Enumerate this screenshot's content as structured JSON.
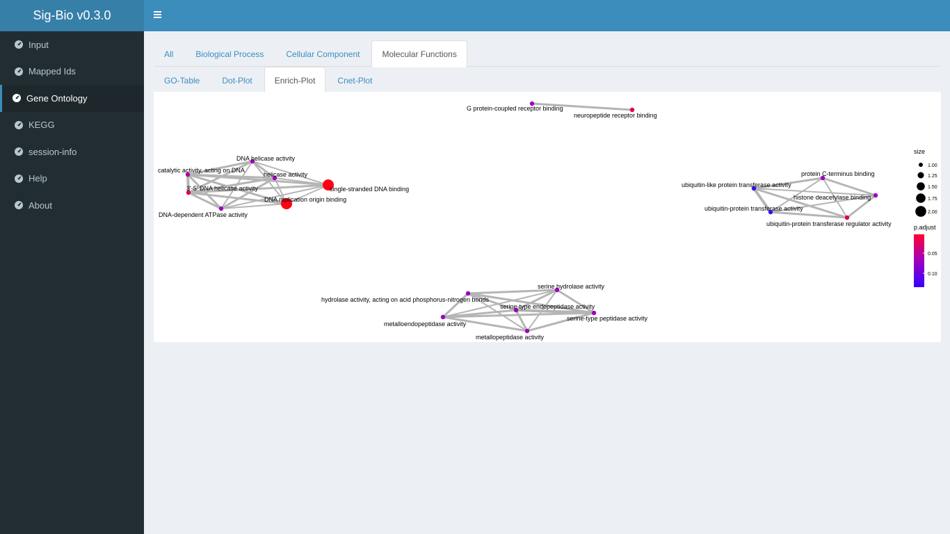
{
  "header": {
    "app_title": "Sig-Bio v0.3.0",
    "menu_icon": "hamburger-icon"
  },
  "sidebar": {
    "items": [
      {
        "label": "Input",
        "icon": "dashboard-icon",
        "active": false
      },
      {
        "label": "Mapped Ids",
        "icon": "dashboard-icon",
        "active": false
      },
      {
        "label": "Gene Ontology",
        "icon": "dashboard-icon",
        "active": true
      },
      {
        "label": "KEGG",
        "icon": "dashboard-icon",
        "active": false
      },
      {
        "label": "session-info",
        "icon": "dashboard-icon",
        "active": false
      },
      {
        "label": "Help",
        "icon": "dashboard-icon",
        "active": false
      },
      {
        "label": "About",
        "icon": "dashboard-icon",
        "active": false
      }
    ]
  },
  "tabs_primary": [
    "All",
    "Biological Process",
    "Cellular Component",
    "Molecular Functions"
  ],
  "tabs_primary_active": "Molecular Functions",
  "tabs_secondary": [
    "GO-Table",
    "Dot-Plot",
    "Enrich-Plot",
    "Cnet-Plot"
  ],
  "tabs_secondary_active": "Enrich-Plot",
  "legend": {
    "size_title": "size",
    "size_labels": [
      "1.00",
      "1.25",
      "1.50",
      "1.75",
      "2.00"
    ],
    "color_title": "p.adjust",
    "color_labels": [
      "0.05",
      "0.10"
    ],
    "color_high": "#ff0033",
    "color_low": "#3300ff"
  },
  "network": {
    "nodes": [
      {
        "id": "gpcr",
        "label": "G protein-coupled receptor binding",
        "size": 1,
        "color": "#a000c0"
      },
      {
        "id": "npr",
        "label": "neuropeptide receptor binding",
        "size": 1,
        "color": "#e00050"
      },
      {
        "id": "dnahel",
        "label": "DNA helicase activity",
        "size": 1,
        "color": "#a000c0"
      },
      {
        "id": "catdna",
        "label": "catalytic activity, acting on DNA",
        "size": 1,
        "color": "#b000a0"
      },
      {
        "id": "helic",
        "label": "helicase activity",
        "size": 1,
        "color": "#a000c0"
      },
      {
        "id": "h35",
        "label": "3'-5' DNA helicase activity",
        "size": 1,
        "color": "#e00040"
      },
      {
        "id": "ssdna",
        "label": "single-stranded DNA binding",
        "size": 2,
        "color": "#ff0015"
      },
      {
        "id": "dnarep",
        "label": "DNA replication origin binding",
        "size": 2,
        "color": "#ff0015"
      },
      {
        "id": "atpase",
        "label": "DNA-dependent ATPase activity",
        "size": 1,
        "color": "#a000c0"
      },
      {
        "id": "protc",
        "label": "protein C-terminus binding",
        "size": 1,
        "color": "#a000c0"
      },
      {
        "id": "ubl",
        "label": "ubiquitin-like protein transferase activity",
        "size": 1,
        "color": "#3010f0"
      },
      {
        "id": "hdac",
        "label": "histone deacetylase binding",
        "size": 1,
        "color": "#a000c0"
      },
      {
        "id": "ubpt",
        "label": "ubiquitin-protein transferase activity",
        "size": 1,
        "color": "#3010f0"
      },
      {
        "id": "ubreg",
        "label": "ubiquitin-protein transferase regulator activity",
        "size": 1,
        "color": "#e00040"
      },
      {
        "id": "serhyd",
        "label": "serine hydrolase activity",
        "size": 1,
        "color": "#a000c0"
      },
      {
        "id": "hydro",
        "label": "hydrolase activity, acting on acid phosphorus-nitrogen bonds",
        "size": 1,
        "color": "#a000c0"
      },
      {
        "id": "serendo",
        "label": "serine-type endopeptidase activity",
        "size": 1,
        "color": "#a000c0"
      },
      {
        "id": "serpep",
        "label": "serine-type peptidase activity",
        "size": 1,
        "color": "#a000c0"
      },
      {
        "id": "metendo",
        "label": "metalloendopeptidase activity",
        "size": 1,
        "color": "#a000c0"
      },
      {
        "id": "metpep",
        "label": "metallopeptidase activity",
        "size": 1,
        "color": "#a000c0"
      }
    ],
    "edges": [
      [
        "gpcr",
        "npr",
        3
      ],
      [
        "dnahel",
        "catdna",
        3
      ],
      [
        "dnahel",
        "helic",
        3
      ],
      [
        "dnahel",
        "h35",
        3
      ],
      [
        "dnahel",
        "atpase",
        2
      ],
      [
        "dnahel",
        "ssdna",
        2
      ],
      [
        "dnahel",
        "dnarep",
        2
      ],
      [
        "catdna",
        "helic",
        3
      ],
      [
        "catdna",
        "h35",
        4
      ],
      [
        "catdna",
        "atpase",
        3
      ],
      [
        "catdna",
        "ssdna",
        3
      ],
      [
        "catdna",
        "dnarep",
        3
      ],
      [
        "helic",
        "h35",
        3
      ],
      [
        "helic",
        "atpase",
        3
      ],
      [
        "helic",
        "ssdna",
        2
      ],
      [
        "helic",
        "dnarep",
        2
      ],
      [
        "h35",
        "atpase",
        3
      ],
      [
        "h35",
        "ssdna",
        3
      ],
      [
        "h35",
        "dnarep",
        3
      ],
      [
        "atpase",
        "ssdna",
        2
      ],
      [
        "atpase",
        "dnarep",
        2
      ],
      [
        "ssdna",
        "dnarep",
        2
      ],
      [
        "protc",
        "ubl",
        3
      ],
      [
        "protc",
        "hdac",
        3
      ],
      [
        "protc",
        "ubpt",
        2
      ],
      [
        "protc",
        "ubreg",
        2
      ],
      [
        "ubl",
        "hdac",
        2
      ],
      [
        "ubl",
        "ubpt",
        4
      ],
      [
        "ubl",
        "ubreg",
        3
      ],
      [
        "hdac",
        "ubpt",
        2
      ],
      [
        "hdac",
        "ubreg",
        3
      ],
      [
        "ubpt",
        "ubreg",
        3
      ],
      [
        "serhyd",
        "hydro",
        3
      ],
      [
        "serhyd",
        "serendo",
        3
      ],
      [
        "serhyd",
        "serpep",
        3
      ],
      [
        "serhyd",
        "metendo",
        2
      ],
      [
        "serhyd",
        "metpep",
        2
      ],
      [
        "hydro",
        "serendo",
        3
      ],
      [
        "hydro",
        "serpep",
        3
      ],
      [
        "hydro",
        "metendo",
        3
      ],
      [
        "hydro",
        "metpep",
        2
      ],
      [
        "serendo",
        "serpep",
        4
      ],
      [
        "serendo",
        "metendo",
        3
      ],
      [
        "serendo",
        "metpep",
        3
      ],
      [
        "serpep",
        "metendo",
        3
      ],
      [
        "serpep",
        "metpep",
        3
      ],
      [
        "metendo",
        "metpep",
        3
      ]
    ]
  }
}
